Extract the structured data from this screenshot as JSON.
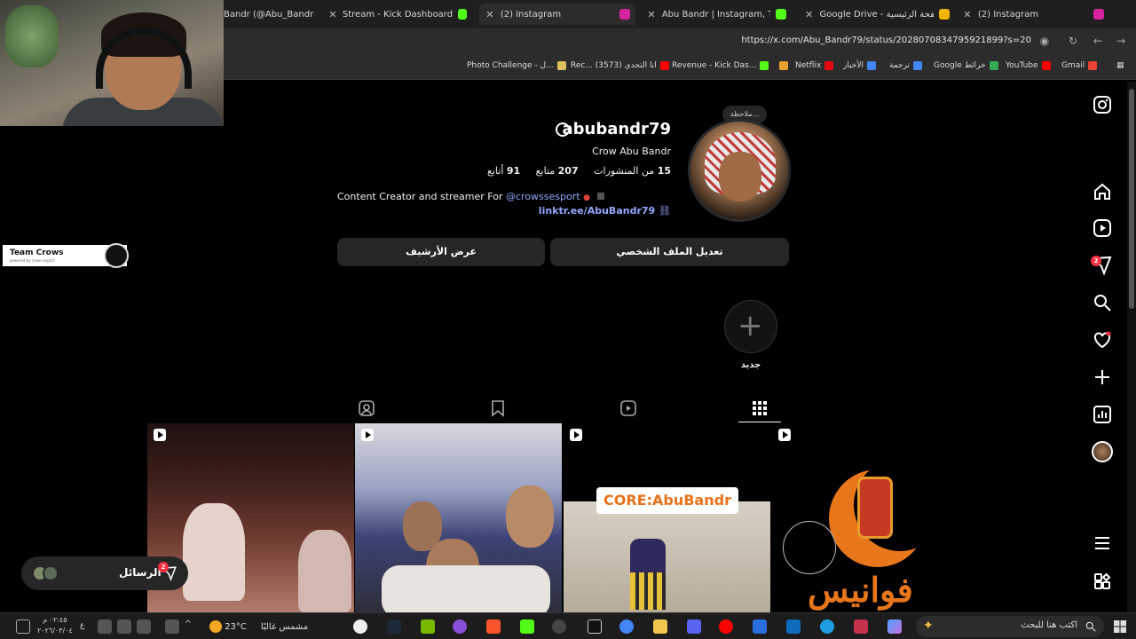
{
  "browser": {
    "tabs": [
      {
        "label": "Bandr (@Abu_Bandr",
        "favicon_color": "#000000",
        "active": false
      },
      {
        "label": "Stream - Kick Dashboard",
        "favicon_color": "#53fc18",
        "active": false
      },
      {
        "label": "(2) Instagram",
        "favicon_color": "#d6249f",
        "active": true
      },
      {
        "label": "Abu Bandr | Instagram, TikTok",
        "favicon_color": "#53fc18",
        "active": false
      },
      {
        "label": "Google Drive - الصفحة الرئيسية",
        "favicon_color": "#f4b400",
        "active": false
      },
      {
        "label": "(2) Instagram",
        "favicon_color": "#d6249f",
        "active": false
      }
    ],
    "url": "https://x.com/Abu_Bandr79/status/2028070834795921899?s=20",
    "bookmarks": [
      {
        "label": "Photo Challenge - ل...",
        "color": "#e0c060"
      },
      {
        "label": "Rec... انا التحدي (3573)",
        "color": "#ff0000"
      },
      {
        "label": "Revenue - Kick Das...",
        "color": "#53fc18"
      },
      {
        "label": "Netflix",
        "color": "#e50914"
      },
      {
        "label": "الأخبار",
        "color": "#4285f4"
      },
      {
        "label": "ترجمة",
        "color": "#4285f4"
      },
      {
        "label": "Google خرائط",
        "color": "#34a853"
      },
      {
        "label": "YouTube",
        "color": "#ff0000"
      },
      {
        "label": "Gmail",
        "color": "#ea4335"
      }
    ]
  },
  "overlay": {
    "team_name": "Team Crows",
    "team_sub": "powered by crows esport"
  },
  "profile": {
    "note": "ملاحظة...",
    "username": "abubandr79",
    "display_name": "Crow Abu Bandr",
    "posts_count": "15",
    "posts_label": "من المنشورات",
    "following_count": "207",
    "following_label": "متابع",
    "followers_count": "91",
    "followers_label": "أتابع",
    "bio_text": "Content Creator and streamer For",
    "bio_mention": "@crowssesport",
    "link": "linktr.ee/AbuBandr79",
    "edit_profile_label": "تعديل الملف الشخصي",
    "view_archive_label": "عرض الأرشيف",
    "new_highlight_label": "جديد"
  },
  "tabs": [
    {
      "icon": "grid-icon",
      "active": true
    },
    {
      "icon": "reels-icon",
      "active": false
    },
    {
      "icon": "saved-icon",
      "active": false
    },
    {
      "icon": "tagged-icon",
      "active": false
    }
  ],
  "posts": [
    {
      "type": "reel",
      "overlay_text": ""
    },
    {
      "type": "reel",
      "overlay_text": ""
    },
    {
      "type": "reel",
      "overlay_text": "CORE:AbuBandr"
    },
    {
      "type": "reel",
      "overlay_text": "فوانيس"
    }
  ],
  "sidebar": {
    "items": [
      "instagram-logo",
      "home",
      "reels",
      "messages",
      "search",
      "notifications",
      "create",
      "insights",
      "profile",
      "more",
      "also-from-meta"
    ],
    "messages_badge": "2"
  },
  "messages_pill": {
    "label": "الرسائل",
    "badge": "2"
  },
  "taskbar": {
    "search_placeholder": "اكتب هنا للبحث",
    "weather_temp": "23°C",
    "weather_text": "مشمس غالبًا",
    "time": "٠٢:٤٥ م",
    "date": "٢٠٢٦/٠٣/٠٤",
    "lang": "ع"
  },
  "colors": {
    "background": "#000000",
    "button": "#262626",
    "link": "#93a6ff",
    "badge": "#ff3040"
  }
}
